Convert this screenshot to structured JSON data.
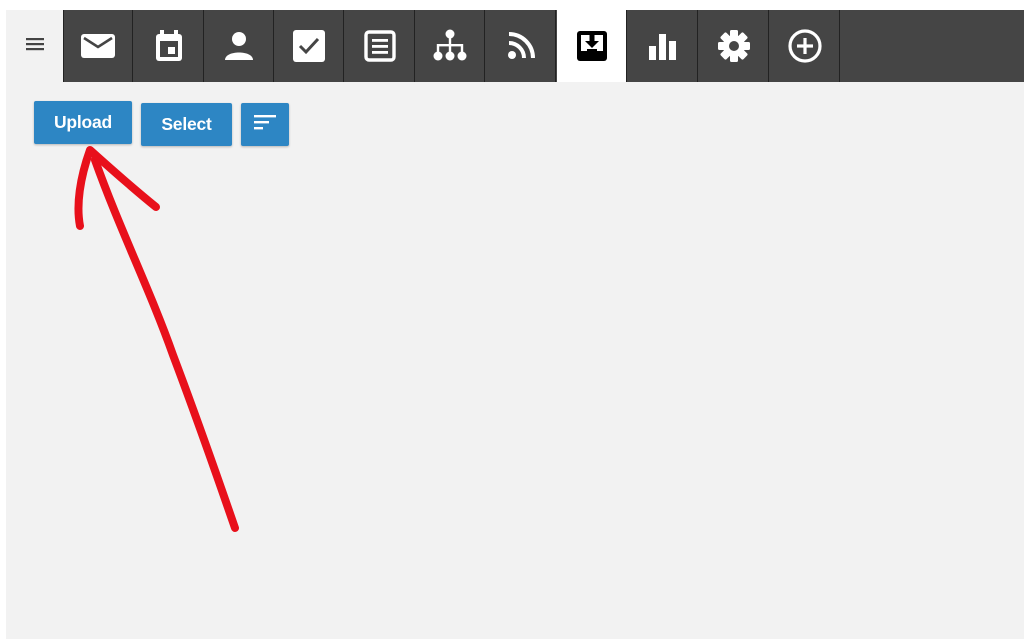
{
  "toolbar": {
    "colors": {
      "bar_background": "#454545",
      "active_tab_background": "#ffffff",
      "icon_color": "#ffffff",
      "active_icon_color": "#000000",
      "button_background": "#2d86c4",
      "annotation_color": "#e8101b"
    },
    "menu_icon": "hamburger-icon",
    "tabs": [
      {
        "icon": "mail-icon",
        "active": false
      },
      {
        "icon": "calendar-icon",
        "active": false
      },
      {
        "icon": "person-icon",
        "active": false
      },
      {
        "icon": "checkbox-icon",
        "active": false
      },
      {
        "icon": "notes-icon",
        "active": false
      },
      {
        "icon": "org-chart-icon",
        "active": false
      },
      {
        "icon": "rss-icon",
        "active": false
      },
      {
        "icon": "inbox-download-icon",
        "active": true
      },
      {
        "icon": "bar-chart-icon",
        "active": false
      },
      {
        "icon": "gear-icon",
        "active": false
      },
      {
        "icon": "add-circle-icon",
        "active": false
      }
    ]
  },
  "actions": {
    "upload_label": "Upload",
    "select_label": "Select",
    "sort_icon": "sort-icon"
  },
  "annotation": {
    "shape": "hand-drawn-arrow",
    "points_to": "upload-button"
  }
}
